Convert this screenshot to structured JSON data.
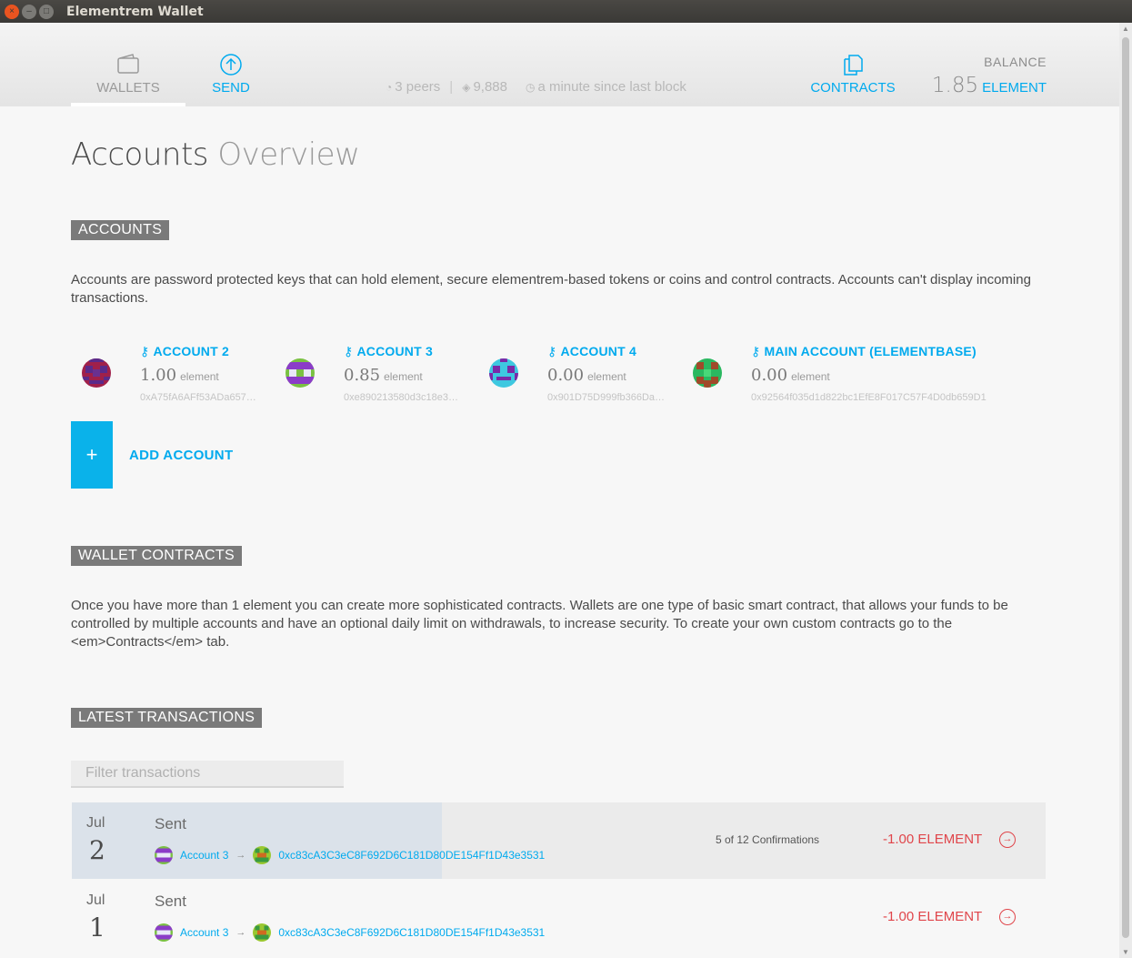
{
  "window": {
    "title": "Elementrem Wallet"
  },
  "nav": {
    "wallets_label": "WALLETS",
    "send_label": "SEND",
    "contracts_label": "CONTRACTS"
  },
  "status": {
    "peers": "3 peers",
    "block": "9,888",
    "last_block": "a minute since last block"
  },
  "balance": {
    "label": "BALANCE",
    "value": "1.85",
    "unit": "ELEMENT"
  },
  "page": {
    "title_main": "Accounts",
    "title_light": "Overview"
  },
  "accounts_section": {
    "heading": "ACCOUNTS",
    "description": "Accounts are password protected keys that can hold element, secure elementrem-based tokens or coins and control contracts. Accounts can't display incoming transactions.",
    "items": [
      {
        "name": "ACCOUNT 2",
        "balance": "1.00",
        "unit": "element",
        "address": "0xA75fA6AFf53ADa657…"
      },
      {
        "name": "ACCOUNT 3",
        "balance": "0.85",
        "unit": "element",
        "address": "0xe890213580d3c18e3…"
      },
      {
        "name": "ACCOUNT 4",
        "balance": "0.00",
        "unit": "element",
        "address": "0x901D75D999fb366Da…"
      },
      {
        "name": "MAIN ACCOUNT (ELEMENTBASE)",
        "balance": "0.00",
        "unit": "element",
        "address": "0x92564f035d1d822bc1EfE8F017C57F4D0db659D1"
      }
    ],
    "add_symbol": "+",
    "add_label": "ADD ACCOUNT"
  },
  "contracts_section": {
    "heading": "WALLET CONTRACTS",
    "description": "Once you have more than 1 element you can create more sophisticated contracts. Wallets are one type of basic smart contract, that allows your funds to be controlled by multiple accounts and have an optional daily limit on withdrawals, to increase security. To create your own custom contracts go to the <em>Contracts</em> tab."
  },
  "transactions_section": {
    "heading": "LATEST TRANSACTIONS",
    "filter_placeholder": "Filter transactions",
    "items": [
      {
        "month": "Jul",
        "day": "2",
        "type": "Sent",
        "from": "Account 3",
        "to": "0xc83cA3C3eC8F692D6C181D80DE154Ff1D43e3531",
        "confirmations": "5 of 12 Confirmations",
        "amount": "-1.00 ELEMENT",
        "progress": 0.38
      },
      {
        "month": "Jul",
        "day": "1",
        "type": "Sent",
        "from": "Account 3",
        "to": "0xc83cA3C3eC8F692D6C181D80DE154Ff1D43e3531",
        "confirmations": "",
        "amount": "-1.00 ELEMENT",
        "progress": 1
      }
    ]
  },
  "colors": {
    "accent": "#00aaee",
    "negative": "#e0454a",
    "section_bg": "#7a7a7a"
  }
}
